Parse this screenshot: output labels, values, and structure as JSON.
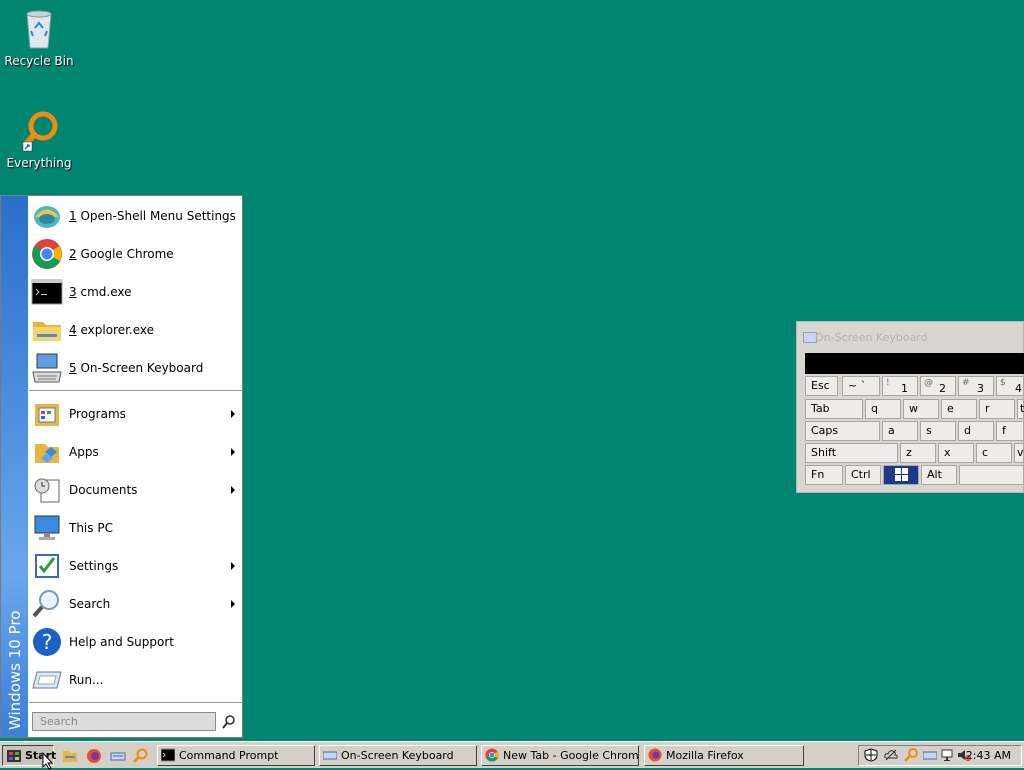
{
  "desktop": {
    "icons": [
      {
        "label": "Recycle Bin"
      },
      {
        "label": "Everything"
      }
    ]
  },
  "start_menu": {
    "banner": "Windows 10 Pro",
    "recent": [
      {
        "num": "1",
        "label": "Open-Shell Menu Settings",
        "icon": "shell-icon"
      },
      {
        "num": "2",
        "label": "Google Chrome",
        "icon": "chrome-icon"
      },
      {
        "num": "3",
        "label": "cmd.exe",
        "icon": "cmd-icon"
      },
      {
        "num": "4",
        "label": "explorer.exe",
        "icon": "folder-icon"
      },
      {
        "num": "5",
        "label": "On-Screen Keyboard",
        "icon": "keyboard-icon"
      }
    ],
    "items": [
      {
        "label": "Programs",
        "arrow": true
      },
      {
        "label": "Apps",
        "arrow": true
      },
      {
        "label": "Documents",
        "arrow": true
      },
      {
        "label": "This PC",
        "arrow": false
      },
      {
        "label": "Settings",
        "arrow": true
      },
      {
        "label": "Search",
        "arrow": true
      },
      {
        "label": "Help and Support",
        "arrow": false
      },
      {
        "label": "Run...",
        "arrow": false
      }
    ],
    "search_placeholder": "Search"
  },
  "osk": {
    "title": "On-Screen Keyboard",
    "rows": {
      "r1": [
        {
          "label": "Esc"
        },
        {
          "sup": "~",
          "label": "`"
        },
        {
          "sup": "!",
          "label": "1"
        },
        {
          "sup": "@",
          "label": "2"
        },
        {
          "sup": "#",
          "label": "3"
        },
        {
          "sup": "$",
          "label": "4"
        }
      ],
      "r2": [
        {
          "label": "Tab"
        },
        {
          "label": "q"
        },
        {
          "label": "w"
        },
        {
          "label": "e"
        },
        {
          "label": "r"
        },
        {
          "label": "t"
        }
      ],
      "r3": [
        {
          "label": "Caps"
        },
        {
          "label": "a"
        },
        {
          "label": "s"
        },
        {
          "label": "d"
        },
        {
          "label": "f"
        }
      ],
      "r4": [
        {
          "label": "Shift"
        },
        {
          "label": "z"
        },
        {
          "label": "x"
        },
        {
          "label": "c"
        },
        {
          "label": "v"
        }
      ],
      "r5": [
        {
          "label": "Fn"
        },
        {
          "label": "Ctrl"
        },
        {
          "label": ""
        },
        {
          "label": "Alt"
        },
        {
          "label": ""
        }
      ]
    }
  },
  "taskbar": {
    "start_label": "Start",
    "tasks": [
      {
        "label": "Command Prompt"
      },
      {
        "label": "On-Screen Keyboard"
      },
      {
        "label": "New Tab - Google Chrome"
      },
      {
        "label": "Mozilla Firefox"
      }
    ],
    "clock": "2:43 AM"
  }
}
